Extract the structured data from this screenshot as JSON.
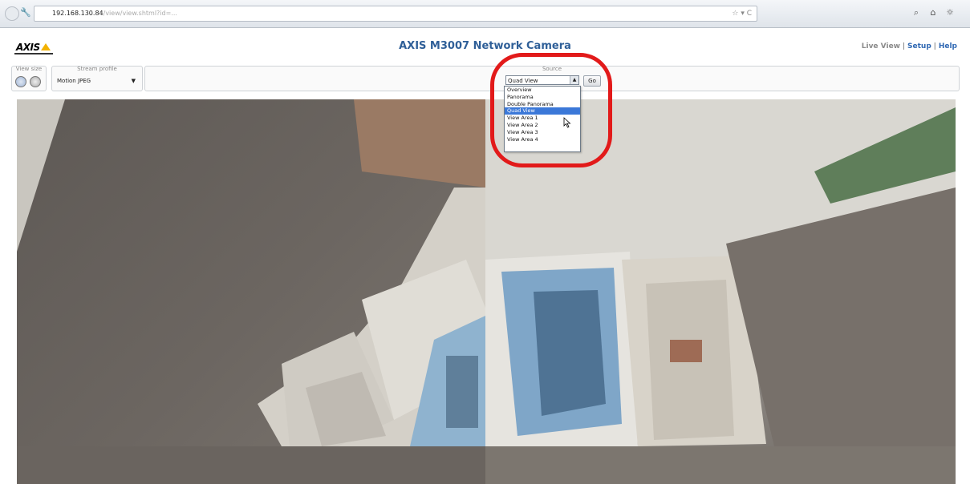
{
  "browser": {
    "address_host": "192.168.130.84",
    "address_path": "/view/view.shtml?id=...",
    "address_controls": "☆ ▾ C"
  },
  "header": {
    "logo_text": "AXIS",
    "title": "AXIS M3007 Network Camera",
    "nav": {
      "live_view": "Live View",
      "sep1": "|",
      "setup": "Setup",
      "sep2": "|",
      "help": "Help"
    }
  },
  "controls": {
    "view_size_label": "View size",
    "stream_profile_label": "Stream profile",
    "stream_profile_value": "Motion JPEG",
    "source_label": "Source",
    "source_value": "Quad View",
    "go_label": "Go",
    "source_options": [
      "Overview",
      "Panorama",
      "Double Panorama",
      "Quad View",
      "View Area 1",
      "View Area 2",
      "View Area 3",
      "View Area 4"
    ],
    "selected_index": 3
  },
  "colors": {
    "title_blue": "#2f5f98",
    "link_blue": "#2f68b3",
    "highlight_red": "#e21a1a",
    "selection_blue": "#3b78d8"
  },
  "icons": [
    "back-icon",
    "site-icon",
    "search-icon",
    "home-icon",
    "gear-icon",
    "cursor-icon"
  ]
}
